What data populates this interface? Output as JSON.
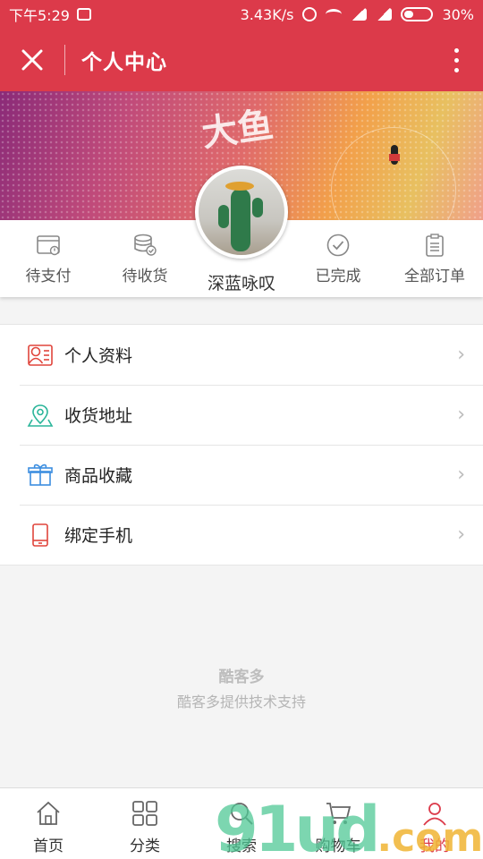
{
  "status_bar": {
    "time": "下午5:29",
    "speed": "3.43K/s",
    "battery": "30%"
  },
  "header": {
    "title": "个人中心"
  },
  "profile": {
    "username": "深蓝咏叹"
  },
  "orders": [
    {
      "label": "待支付",
      "icon": "wallet-icon"
    },
    {
      "label": "待收货",
      "icon": "coins-icon"
    },
    {
      "label": "已完成",
      "icon": "check-circle-icon"
    },
    {
      "label": "全部订单",
      "icon": "clipboard-icon"
    }
  ],
  "menu": [
    {
      "label": "个人资料",
      "icon": "profile-card-icon"
    },
    {
      "label": "收货地址",
      "icon": "map-pin-icon"
    },
    {
      "label": "商品收藏",
      "icon": "gift-icon"
    },
    {
      "label": "绑定手机",
      "icon": "phone-icon"
    }
  ],
  "support": {
    "brand": "酷客多",
    "text": "酷客多提供技术支持"
  },
  "tabs": [
    {
      "label": "首页",
      "icon": "home-icon"
    },
    {
      "label": "分类",
      "icon": "grid-icon"
    },
    {
      "label": "搜索",
      "icon": "search-icon"
    },
    {
      "label": "购物车",
      "icon": "cart-icon"
    },
    {
      "label": "我的",
      "icon": "user-icon"
    }
  ],
  "colors": {
    "brand": "#dc3a4a",
    "menu_red": "#e0453c",
    "menu_green": "#2bb59a",
    "menu_blue": "#3c8ee0"
  },
  "banner_text": "大鱼",
  "watermark": {
    "main": "91ud",
    "tld": ".com"
  }
}
